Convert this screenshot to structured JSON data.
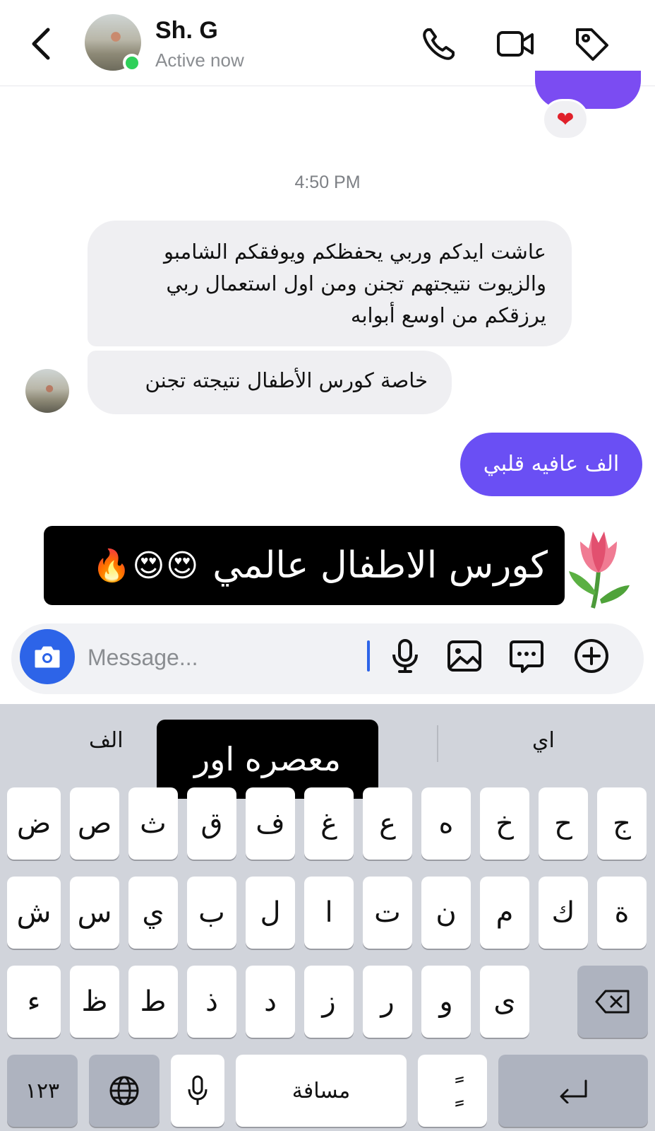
{
  "header": {
    "contact_name": "Sh. G",
    "status": "Active now",
    "icons": [
      "chevron-left-icon",
      "phone-icon",
      "video-icon",
      "tag-icon"
    ]
  },
  "chat": {
    "top_reaction": "❤",
    "timestamp": "4:50 PM",
    "incoming": [
      "عاشت ايدكم وربي يحفظكم ويوفقكم الشامبو والزيوت نتيجتهم تجنن ومن اول استعمال ربي يرزقكم من اوسع أبوابه",
      "خاصة كورس الأطفال نتيجته تجنن"
    ],
    "outgoing": "الف عافيه قلبي"
  },
  "caption": {
    "text": "كورس الاطفال عالمي",
    "emoji": "😍😍🔥"
  },
  "composer": {
    "placeholder": "Message...",
    "value": ""
  },
  "keyboard": {
    "suggestions": {
      "left": "الف",
      "center": "معصره اور",
      "right": "اي"
    },
    "row1": [
      "ج",
      "ح",
      "خ",
      "ه",
      "ع",
      "غ",
      "ف",
      "ق",
      "ث",
      "ص",
      "ض"
    ],
    "row2": [
      "ة",
      "ك",
      "م",
      "ن",
      "ت",
      "ا",
      "ل",
      "ب",
      "ي",
      "س",
      "ش"
    ],
    "row3": [
      "ى",
      "و",
      "ر",
      "ز",
      "د",
      "ذ",
      "ط",
      "ظ",
      "ء"
    ],
    "numbers_key": "١٢٣",
    "space_key": "مسافة",
    "diacritic_key": "ًٍ"
  }
}
